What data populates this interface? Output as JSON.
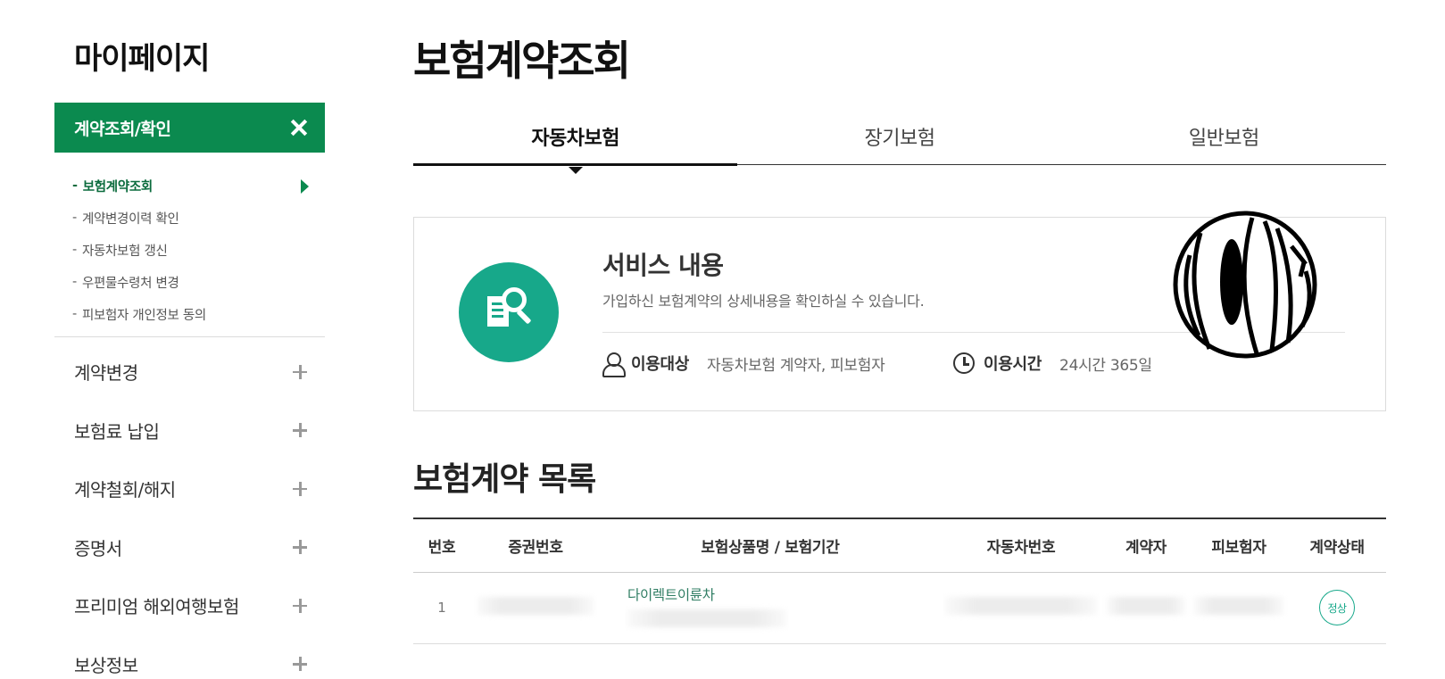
{
  "sidebar": {
    "title": "마이페이지",
    "active_section": "계약조회/확인",
    "sub_items": [
      {
        "label": "보험계약조회",
        "current": true
      },
      {
        "label": "계약변경이력 확인",
        "current": false
      },
      {
        "label": "자동차보험 갱신",
        "current": false
      },
      {
        "label": "우편물수령처 변경",
        "current": false
      },
      {
        "label": "피보험자 개인정보 동의",
        "current": false
      }
    ],
    "menu_items": [
      {
        "label": "계약변경"
      },
      {
        "label": "보험료 납입"
      },
      {
        "label": "계약철회/해지"
      },
      {
        "label": "증명서"
      },
      {
        "label": "프리미엄 해외여행보험"
      },
      {
        "label": "보상정보"
      }
    ],
    "sub_prefix": "-"
  },
  "main": {
    "page_title": "보험계약조회",
    "tabs": [
      {
        "label": "자동차보험",
        "active": true
      },
      {
        "label": "장기보험",
        "active": false
      },
      {
        "label": "일반보험",
        "active": false
      }
    ],
    "service": {
      "title": "서비스 내용",
      "description": "가입하신 보험계약의 상세내용을 확인하실 수 있습니다.",
      "target_label": "이용대상",
      "target_value": "자동차보험 계약자, 피보험자",
      "time_label": "이용시간",
      "time_value": "24시간 365일"
    },
    "list_title": "보험계약 목록",
    "table": {
      "headers": [
        "번호",
        "증권번호",
        "보험상품명 / 보험기간",
        "자동차번호",
        "계약자",
        "피보험자",
        "계약상태"
      ],
      "rows": [
        {
          "no": "1",
          "product_name": "다이렉트이륜차",
          "status": "정상"
        }
      ]
    }
  },
  "colors": {
    "brand_green": "#0b8a4f",
    "accent_teal": "#17a88a"
  },
  "icons": {
    "close": "close-icon",
    "expand": "plus-icon",
    "current_pointer": "triangle-right-icon",
    "service": "document-search-icon",
    "target": "person-icon",
    "time": "clock-icon"
  }
}
